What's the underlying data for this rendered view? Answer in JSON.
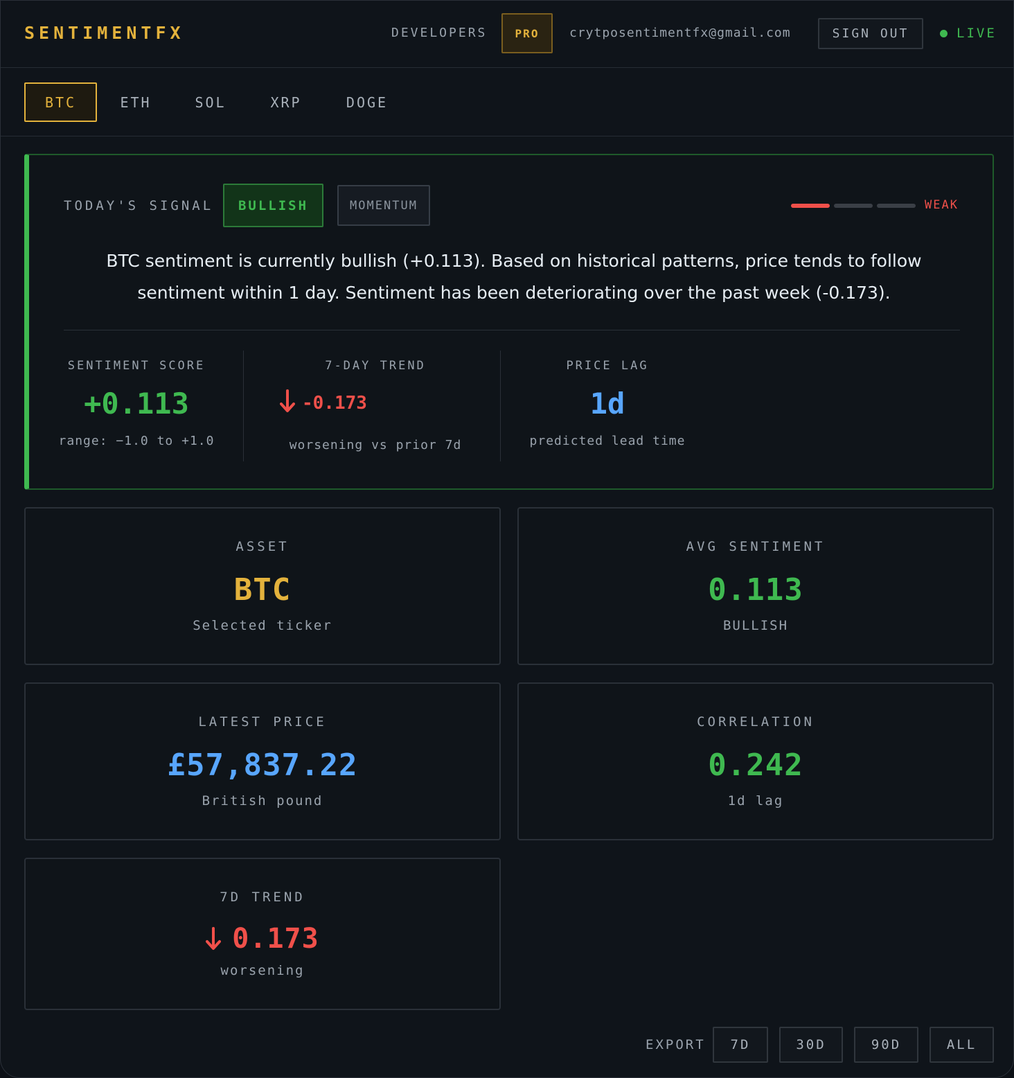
{
  "header": {
    "brand": "SENTIMENTFX",
    "developers_label": "DEVELOPERS",
    "pro_label": "PRO",
    "email": "crytposentimentfx@gmail.com",
    "signout_label": "SIGN OUT",
    "live_label": "LIVE"
  },
  "tabs": [
    {
      "label": "BTC",
      "active": true
    },
    {
      "label": "ETH",
      "active": false
    },
    {
      "label": "SOL",
      "active": false
    },
    {
      "label": "XRP",
      "active": false
    },
    {
      "label": "DOGE",
      "active": false
    }
  ],
  "signal": {
    "label": "TODAY'S SIGNAL",
    "direction_badge": "BULLISH",
    "type_badge": "MOMENTUM",
    "strength_label": "WEAK",
    "strength_level": 1,
    "strength_max": 3,
    "text": "BTC sentiment is currently bullish (+0.113). Based on historical patterns, price tends to follow sentiment within 1 day. Sentiment has been deteriorating over the past week (-0.173).",
    "metrics": {
      "score": {
        "label": "SENTIMENT SCORE",
        "value": "+0.113",
        "sub": "range: −1.0 to +1.0"
      },
      "trend": {
        "label": "7-DAY TREND",
        "value": "-0.173",
        "sub": "worsening vs prior 7d"
      },
      "lag": {
        "label": "PRICE LAG",
        "value": "1d",
        "sub": "predicted lead time"
      }
    }
  },
  "cards": {
    "asset": {
      "label": "ASSET",
      "value": "BTC",
      "sub": "Selected ticker"
    },
    "avg_sentiment": {
      "label": "AVG SENTIMENT",
      "value": "0.113",
      "sub": "BULLISH"
    },
    "latest_price": {
      "label": "LATEST PRICE",
      "value": "£57,837.22",
      "sub": "British pound"
    },
    "correlation": {
      "label": "CORRELATION",
      "value": "0.242",
      "sub": "1d lag"
    },
    "trend_7d": {
      "label": "7D TREND",
      "value": "0.173",
      "sub": "worsening"
    }
  },
  "export": {
    "label": "EXPORT",
    "ranges": [
      "7D",
      "30D",
      "90D",
      "ALL"
    ]
  },
  "colors": {
    "accent_gold": "#e3b23c",
    "bullish_green": "#3fb950",
    "bearish_red": "#f0504a",
    "price_blue": "#58a6ff",
    "background": "#0f141a"
  },
  "icons": {
    "trend_arrow": "arrow-down-icon",
    "live_indicator": "status-dot-icon"
  }
}
